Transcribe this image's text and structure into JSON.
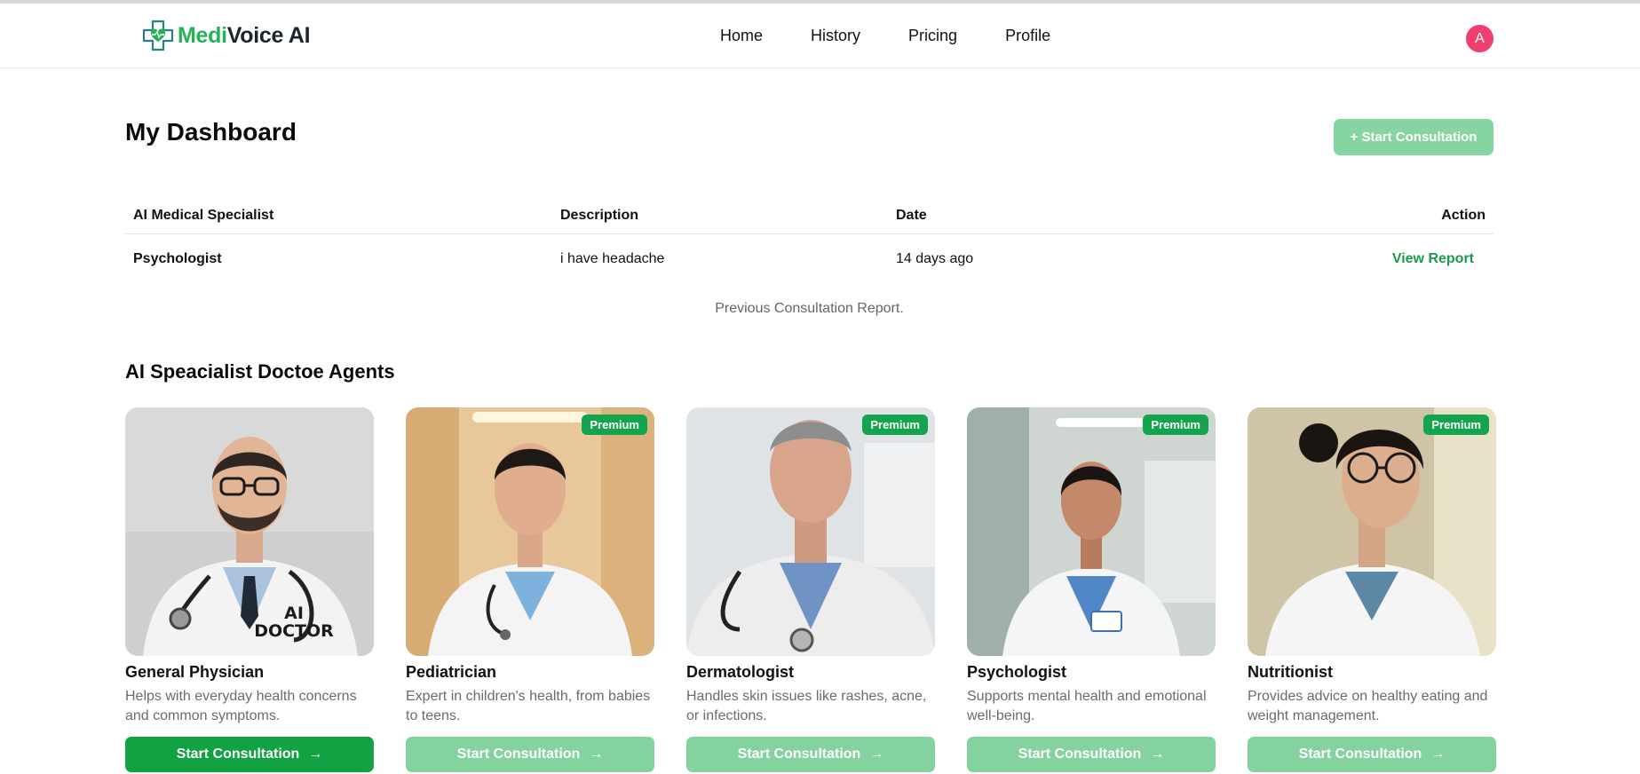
{
  "brand": {
    "part1": "Medi",
    "part2": "Voice AI",
    "accent": "#22b357"
  },
  "nav": {
    "items": [
      "Home",
      "History",
      "Pricing",
      "Profile"
    ]
  },
  "user": {
    "avatar_letter": "A",
    "avatar_color": "#ef3f6f"
  },
  "dashboard": {
    "title": "My Dashboard",
    "start_button": "+ Start Consultation",
    "table": {
      "headers": [
        "AI Medical Specialist",
        "Description",
        "Date",
        "Action"
      ],
      "rows": [
        {
          "specialist": "Psychologist",
          "description": "i have headache",
          "date": "14 days ago",
          "action": "View Report"
        }
      ],
      "caption": "Previous Consultation Report."
    }
  },
  "agents": {
    "title": "AI Speacialist Doctoe Agents",
    "badge": "Premium",
    "button_label": "Start Consultation",
    "items": [
      {
        "name": "General Physician",
        "desc": "Helps with everyday health concerns and common symptoms.",
        "premium": false,
        "image_label": "AI DOCTOR"
      },
      {
        "name": "Pediatrician",
        "desc": "Expert in children's health, from babies to teens.",
        "premium": true
      },
      {
        "name": "Dermatologist",
        "desc": "Handles skin issues like rashes, acne, or infections.",
        "premium": true
      },
      {
        "name": "Psychologist",
        "desc": "Supports mental health and emotional well-being.",
        "premium": true
      },
      {
        "name": "Nutritionist",
        "desc": "Provides advice on healthy eating and weight management.",
        "premium": true
      }
    ]
  }
}
